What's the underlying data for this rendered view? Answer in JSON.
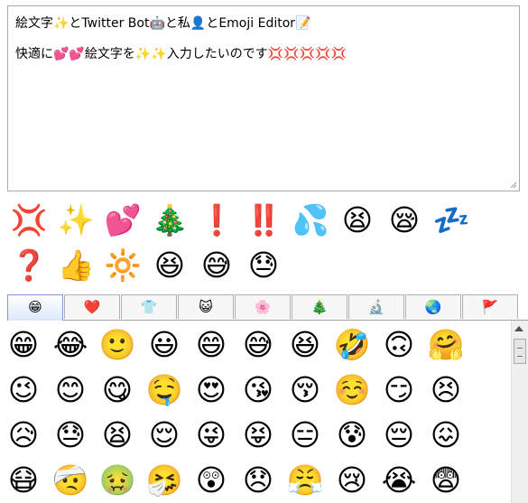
{
  "editor": {
    "line1": "絵文字✨とTwitter Bot🤖と私👤とEmoji Editor📝",
    "line2": "快適に💕💕絵文字を✨✨入力したいのです💢💢💢💢💢"
  },
  "recent": [
    "💢",
    "✨",
    "💕",
    "🎄",
    "❗",
    "‼️",
    "💦",
    "😫",
    "😪",
    "💤",
    "❓",
    "👍",
    "🔆",
    "😆",
    "😅",
    "😓"
  ],
  "tabs": [
    {
      "icon": "😁",
      "name": "smileys"
    },
    {
      "icon": "❤️",
      "name": "hearts"
    },
    {
      "icon": "👕",
      "name": "clothing"
    },
    {
      "icon": "😺",
      "name": "animals"
    },
    {
      "icon": "🌸",
      "name": "nature"
    },
    {
      "icon": "🎄",
      "name": "events"
    },
    {
      "icon": "🔬",
      "name": "objects"
    },
    {
      "icon": "🌏",
      "name": "places"
    },
    {
      "icon": "🚩",
      "name": "symbols"
    }
  ],
  "active_tab": "smileys",
  "grid": [
    "😁",
    "😂",
    "🙂",
    "😃",
    "😄",
    "😅",
    "😆",
    "🤣",
    "🙃",
    "🤗",
    "😉",
    "😊",
    "😋",
    "🤤",
    "😍",
    "😘",
    "😚",
    "☺️",
    "😏",
    "😣",
    "😥",
    "😓",
    "😫",
    "😌",
    "😜",
    "😝",
    "😑",
    "😰",
    "😔",
    "😖",
    "😷",
    "🤕",
    "🤢",
    "🤧",
    "😲",
    "😞",
    "😤",
    "😢",
    "😭",
    "😨"
  ]
}
